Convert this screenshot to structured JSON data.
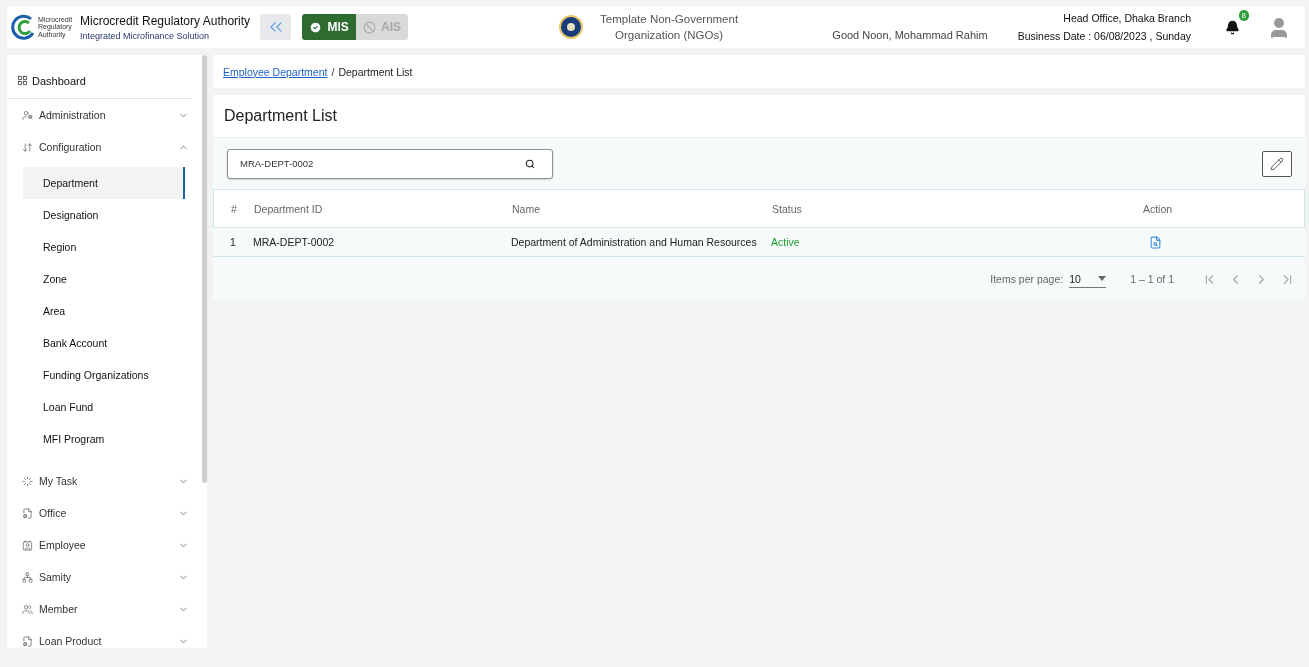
{
  "header": {
    "logo_text": "Microcredit Regulatory Authority",
    "title": "Microcredit Regulatory Authority",
    "subtitle": "Integrated Microfinance Solution",
    "modules": [
      {
        "label": "MIS",
        "selected": true
      },
      {
        "label": "AIS",
        "selected": false
      }
    ],
    "organization": "Template Non-Government Organization (NGOs)",
    "greeting": "Good Noon, Mohammad Rahim",
    "office": "Head Office, Dhaka Branch",
    "business_date": "Business Date : 06/08/2023 , Sunday",
    "notification_count": "8"
  },
  "sidebar": {
    "items": [
      {
        "kind": "link",
        "label": "Dashboard"
      },
      {
        "kind": "group",
        "label": "Administration",
        "expanded": false
      },
      {
        "kind": "group",
        "label": "Configuration",
        "expanded": true,
        "children": [
          {
            "label": "Department",
            "selected": true
          },
          {
            "label": "Designation",
            "selected": false
          },
          {
            "label": "Region",
            "selected": false
          },
          {
            "label": "Zone",
            "selected": false
          },
          {
            "label": "Area",
            "selected": false
          },
          {
            "label": "Bank Account",
            "selected": false
          },
          {
            "label": "Funding Organizations",
            "selected": false
          },
          {
            "label": "Loan Fund",
            "selected": false
          },
          {
            "label": "MFI Program",
            "selected": false
          }
        ]
      },
      {
        "kind": "group",
        "label": "My Task",
        "expanded": false
      },
      {
        "kind": "group",
        "label": "Office",
        "expanded": false
      },
      {
        "kind": "group",
        "label": "Employee",
        "expanded": false
      },
      {
        "kind": "group",
        "label": "Samity",
        "expanded": false
      },
      {
        "kind": "group",
        "label": "Member",
        "expanded": false
      },
      {
        "kind": "group",
        "label": "Loan Product",
        "expanded": false
      }
    ]
  },
  "breadcrumb": {
    "link": "Employee Department",
    "separator": "/",
    "current": "Department List"
  },
  "page_title": "Department List",
  "search": {
    "value": "MRA-DEPT-0002"
  },
  "table": {
    "columns": [
      "#",
      "Department ID",
      "Name",
      "Status",
      "Action"
    ],
    "rows": [
      {
        "index": "1",
        "department_id": "MRA-DEPT-0002",
        "name": "Department of Administration and Human Resources",
        "status": "Active",
        "color": "#1e9e2e"
      }
    ]
  },
  "paginator": {
    "label": "Items per page:",
    "page_size": "10",
    "range": "1 – 1 of 1"
  }
}
